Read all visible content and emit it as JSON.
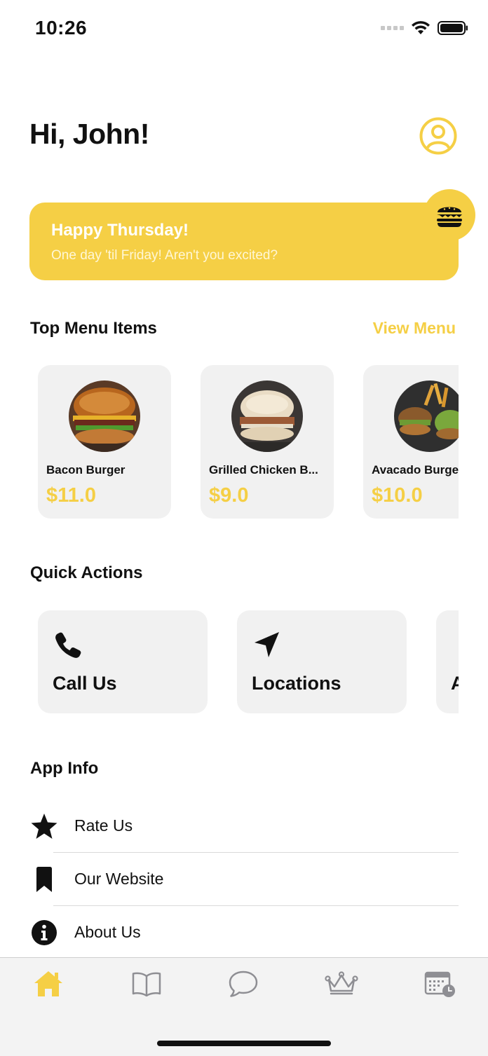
{
  "status_bar": {
    "time": "10:26"
  },
  "header": {
    "greeting": "Hi, John!",
    "profile_icon": "user-circle-icon"
  },
  "banner": {
    "title": "Happy Thursday!",
    "subtitle": "One day 'til Friday! Aren't you excited?",
    "badge_icon": "burger-icon"
  },
  "top_menu": {
    "title": "Top Menu Items",
    "view_link": "View Menu",
    "items": [
      {
        "name": "Bacon Burger",
        "price": "$11.0"
      },
      {
        "name": "Grilled Chicken B...",
        "price": "$9.0"
      },
      {
        "name": "Avacado Burger",
        "price": "$10.0"
      }
    ]
  },
  "quick_actions": {
    "title": "Quick Actions",
    "items": [
      {
        "label": "Call Us",
        "icon": "phone-icon"
      },
      {
        "label": "Locations",
        "icon": "location-arrow-icon"
      },
      {
        "label": "A",
        "icon": ""
      }
    ]
  },
  "app_info": {
    "title": "App Info",
    "items": [
      {
        "label": "Rate Us",
        "icon": "star-icon"
      },
      {
        "label": "Our Website",
        "icon": "bookmark-icon"
      },
      {
        "label": "About Us",
        "icon": "info-icon"
      }
    ]
  },
  "tab_bar": {
    "tabs": [
      {
        "icon": "home-icon",
        "active": true
      },
      {
        "icon": "book-icon",
        "active": false
      },
      {
        "icon": "chat-bubble-icon",
        "active": false
      },
      {
        "icon": "crown-icon",
        "active": false
      },
      {
        "icon": "calendar-clock-icon",
        "active": false
      }
    ]
  },
  "colors": {
    "accent": "#F5CF45",
    "card": "#F1F1F1",
    "tab_inactive": "#8E8E93"
  }
}
